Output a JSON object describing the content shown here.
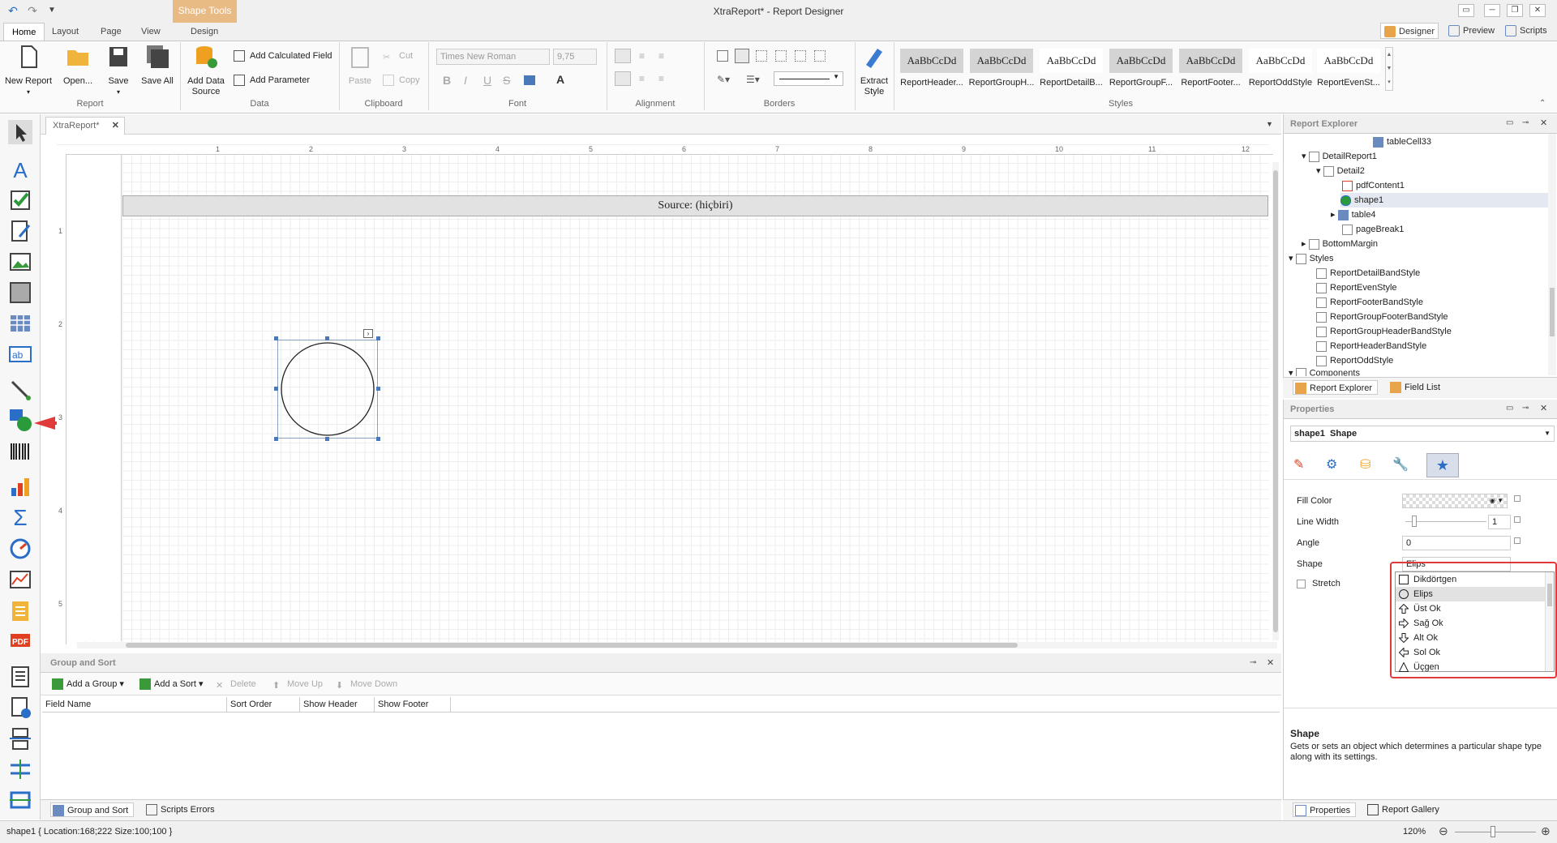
{
  "window": {
    "title": "XtraReport* - Report Designer",
    "context_tab": "Shape Tools"
  },
  "ribbon_tabs": [
    "Home",
    "Layout",
    "Page",
    "View",
    "Design"
  ],
  "right_top_buttons": {
    "designer": "Designer",
    "preview": "Preview",
    "scripts": "Scripts"
  },
  "ribbon": {
    "report": {
      "name": "Report",
      "new": "New Report",
      "open": "Open...",
      "save": "Save",
      "save_all": "Save All"
    },
    "data": {
      "name": "Data",
      "add_data_source": "Add Data Source",
      "add_calculated_field": "Add Calculated Field",
      "add_parameter": "Add Parameter"
    },
    "clipboard": {
      "name": "Clipboard",
      "paste": "Paste",
      "cut": "Cut",
      "copy": "Copy"
    },
    "font": {
      "name": "Font",
      "family": "Times New Roman",
      "size": "9,75"
    },
    "alignment": {
      "name": "Alignment"
    },
    "borders": {
      "name": "Borders"
    },
    "extract": {
      "label": "Extract Style"
    },
    "styles": {
      "name": "Styles",
      "sample": "AaBbCcDd",
      "items": [
        "ReportHeader...",
        "ReportGroupH...",
        "ReportDetailB...",
        "ReportGroupF...",
        "ReportFooter...",
        "ReportOddStyle",
        "ReportEvenSt..."
      ]
    }
  },
  "doc_tab": "XtraReport*",
  "ruler": {
    "h": [
      "1",
      "2",
      "3",
      "4",
      "5",
      "6",
      "7",
      "8",
      "9",
      "10",
      "11",
      "12"
    ],
    "v": [
      "1",
      "2",
      "3",
      "4",
      "5"
    ]
  },
  "band_text": "Source: (hiçbiri)",
  "group_sort": {
    "title": "Group and Sort",
    "add_group": "Add a Group",
    "add_sort": "Add a Sort",
    "delete": "Delete",
    "move_up": "Move Up",
    "move_down": "Move Down",
    "columns": [
      "Field Name",
      "Sort Order",
      "Show Header",
      "Show Footer"
    ]
  },
  "bottom_tabs": [
    "Group and Sort",
    "Scripts Errors"
  ],
  "report_explorer": {
    "title": "Report Explorer",
    "items": [
      "tableCell33",
      "DetailReport1",
      "Detail2",
      "pdfContent1",
      "shape1",
      "table4",
      "pageBreak1",
      "BottomMargin",
      "Styles",
      "ReportDetailBandStyle",
      "ReportEvenStyle",
      "ReportFooterBandStyle",
      "ReportGroupFooterBandStyle",
      "ReportGroupHeaderBandStyle",
      "ReportHeaderBandStyle",
      "ReportOddStyle",
      "Components"
    ],
    "tabs": [
      "Report Explorer",
      "Field List"
    ]
  },
  "properties": {
    "title": "Properties",
    "selector_name": "shape1",
    "selector_type": "Shape",
    "fill_color": "Fill Color",
    "line_width": "Line Width",
    "line_width_val": "1",
    "angle": "Angle",
    "angle_val": "0",
    "shape": "Shape",
    "shape_val": "Elips",
    "stretch": "Stretch",
    "options": [
      "Dikdörtgen",
      "Elips",
      "Üst Ok",
      "Sağ Ok",
      "Alt Ok",
      "Sol Ok",
      "Üçgen"
    ],
    "desc_title": "Shape",
    "desc_text": "Gets or sets an object which determines a particular shape type along with its settings.",
    "tabs": [
      "Properties",
      "Report Gallery"
    ]
  },
  "status": {
    "left": "shape1 { Location:168;222 Size:100;100 }",
    "zoom": "120%"
  },
  "colors": {
    "accent": "#1e6fc4",
    "context": "#e8ba84",
    "annotation": "#e03a3a"
  }
}
